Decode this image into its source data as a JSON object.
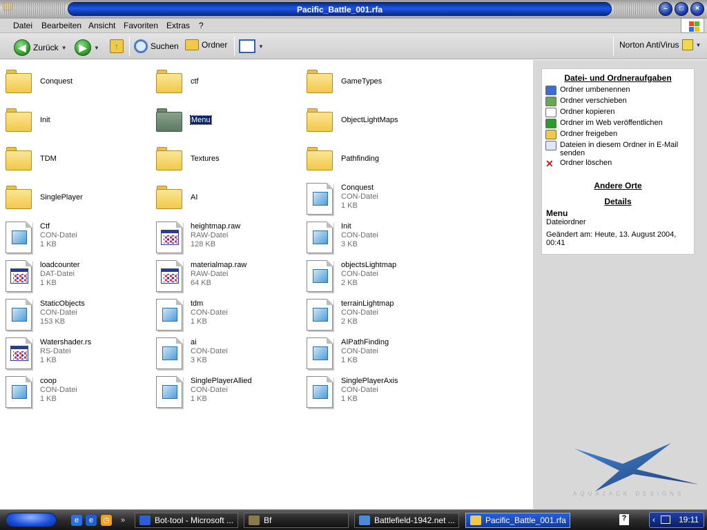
{
  "window": {
    "title": "Pacific_Battle_001.rfa"
  },
  "menubar": {
    "items": [
      "Datei",
      "Bearbeiten",
      "Ansicht",
      "Favoriten",
      "Extras",
      "?"
    ]
  },
  "toolbar": {
    "back": "Zurück",
    "search": "Suchen",
    "folders": "Ordner",
    "norton": "Norton AntiVirus"
  },
  "files": [
    {
      "name": "Conquest",
      "kind": "folder"
    },
    {
      "name": "ctf",
      "kind": "folder"
    },
    {
      "name": "GameTypes",
      "kind": "folder"
    },
    {
      "name": "Init",
      "kind": "folder"
    },
    {
      "name": "Menu",
      "kind": "folder",
      "selected": true
    },
    {
      "name": "ObjectLightMaps",
      "kind": "folder"
    },
    {
      "name": "TDM",
      "kind": "folder"
    },
    {
      "name": "Textures",
      "kind": "folder"
    },
    {
      "name": "Pathfinding",
      "kind": "folder"
    },
    {
      "name": "SinglePlayer",
      "kind": "folder"
    },
    {
      "name": "AI",
      "kind": "folder"
    },
    {
      "name": "Conquest",
      "type": "CON-Datei",
      "size": "1 KB",
      "kind": "doc"
    },
    {
      "name": "Ctf",
      "type": "CON-Datei",
      "size": "1 KB",
      "kind": "doc"
    },
    {
      "name": "heightmap.raw",
      "type": "RAW-Datei",
      "size": "128 KB",
      "kind": "prog"
    },
    {
      "name": "Init",
      "type": "CON-Datei",
      "size": "3 KB",
      "kind": "doc"
    },
    {
      "name": "loadcounter",
      "type": "DAT-Datei",
      "size": "1 KB",
      "kind": "prog"
    },
    {
      "name": "materialmap.raw",
      "type": "RAW-Datei",
      "size": "64 KB",
      "kind": "prog"
    },
    {
      "name": "objectsLightmap",
      "type": "CON-Datei",
      "size": "2 KB",
      "kind": "doc"
    },
    {
      "name": "StaticObjects",
      "type": "CON-Datei",
      "size": "153 KB",
      "kind": "doc"
    },
    {
      "name": "tdm",
      "type": "CON-Datei",
      "size": "1 KB",
      "kind": "doc"
    },
    {
      "name": "terrainLightmap",
      "type": "CON-Datei",
      "size": "2 KB",
      "kind": "doc"
    },
    {
      "name": "Watershader.rs",
      "type": "RS-Datei",
      "size": "1 KB",
      "kind": "prog"
    },
    {
      "name": "ai",
      "type": "CON-Datei",
      "size": "3 KB",
      "kind": "doc"
    },
    {
      "name": "AIPathFinding",
      "type": "CON-Datei",
      "size": "1 KB",
      "kind": "doc"
    },
    {
      "name": "coop",
      "type": "CON-Datei",
      "size": "1 KB",
      "kind": "doc"
    },
    {
      "name": "SinglePlayerAllied",
      "type": "CON-Datei",
      "size": "1 KB",
      "kind": "doc"
    },
    {
      "name": "SinglePlayerAxis",
      "type": "CON-Datei",
      "size": "1 KB",
      "kind": "doc"
    }
  ],
  "taskpane": {
    "tasks_title": "Datei- und Ordneraufgaben",
    "tasks": [
      {
        "label": "Ordner umbenennen",
        "icon": "rename-icon"
      },
      {
        "label": "Ordner verschieben",
        "icon": "move-icon"
      },
      {
        "label": "Ordner kopieren",
        "icon": "copy-icon"
      },
      {
        "label": "Ordner im Web veröffentlichen",
        "icon": "web-publish-icon"
      },
      {
        "label": "Ordner freigeben",
        "icon": "share-icon"
      },
      {
        "label": "Dateien in diesem Ordner in E-Mail senden",
        "icon": "email-icon"
      },
      {
        "label": "Ordner löschen",
        "icon": "delete-icon"
      }
    ],
    "other_places": "Andere Orte",
    "details": "Details",
    "detail_name": "Menu",
    "detail_type": "Dateiordner",
    "detail_modified": "Geändert am: Heute, 13. August 2004, 00:41",
    "brand": "AQUAJACK DESIGNS"
  },
  "taskbar": {
    "tasks": [
      "Bot-tool - Microsoft ...",
      "Bf",
      "Battlefield-1942.net ...",
      "Pacific_Battle_001.rfa"
    ],
    "time": "19:11"
  },
  "colors": {
    "title_blue": "#1c56e8",
    "selection": "#0a246a",
    "taskbar_active": "#2b5fd8"
  }
}
